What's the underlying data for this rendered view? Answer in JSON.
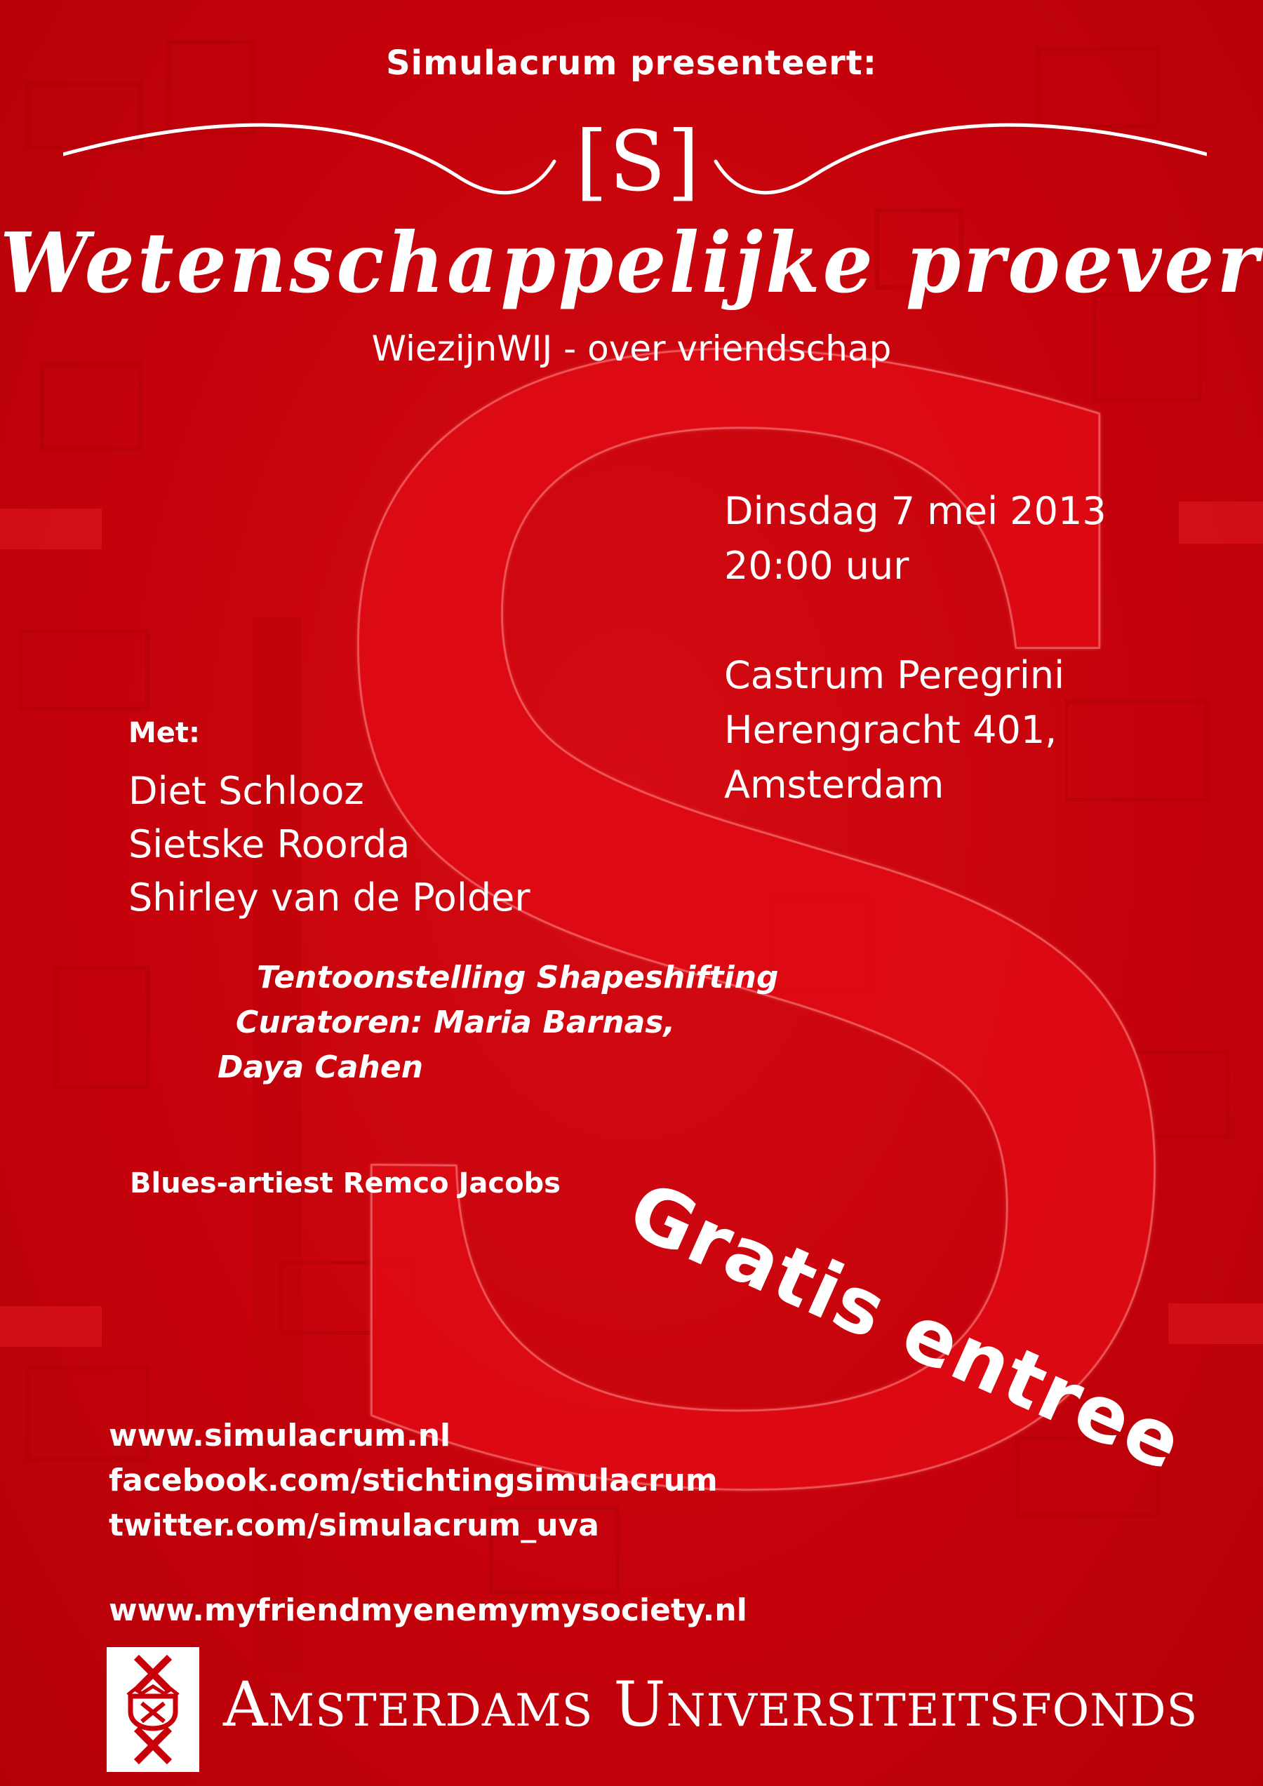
{
  "presenter": "Simulacrum presenteert:",
  "logo": "[S]",
  "title": "Wetenschappelijke proeverij",
  "subtitle": "WiezijnWIJ - over vriendschap",
  "event": {
    "date": "Dinsdag 7 mei 2013",
    "time": "20:00 uur",
    "venue": "Castrum Peregrini",
    "address": "Herengracht 401,",
    "city": "Amsterdam"
  },
  "with_label": "Met:",
  "speakers": [
    "Diet Schlooz",
    "Sietske Roorda",
    "Shirley van de Polder"
  ],
  "exhibition": {
    "line1": "Tentoonstelling Shapeshifting",
    "line2": "Curatoren: Maria Barnas,",
    "line3": "Daya Cahen"
  },
  "musician": "Blues-artiest Remco Jacobs",
  "badge": "Gratis entree",
  "links": [
    "www.simulacrum.nl",
    "facebook.com/stichtingsimulacrum",
    "twitter.com/simulacrum_uva"
  ],
  "partner_site": "www.myfriendmyenemymysociety.nl",
  "sponsor": {
    "word1_initial": "A",
    "word1_rest": "MSTERDAMS",
    "word2_initial": "U",
    "word2_rest": "NIVERSITEITSFONDS"
  },
  "colors": {
    "background": "#c8000a",
    "text": "#ffffff",
    "emblem_red": "#c8000a"
  }
}
